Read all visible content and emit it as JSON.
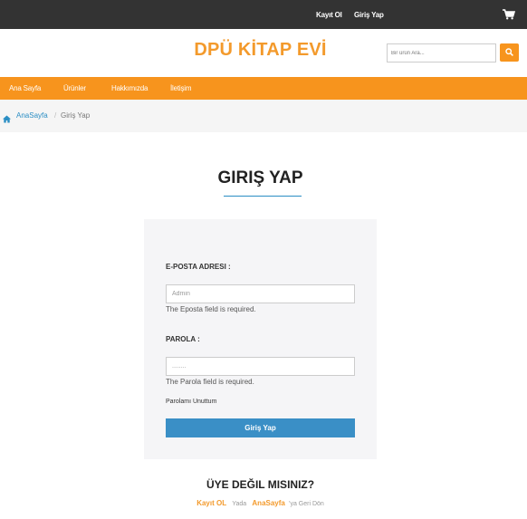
{
  "topbar": {
    "register_label": "Kayıt Ol",
    "login_label": "Giriş Yap",
    "cart_icon": "shopping-cart-icon"
  },
  "header": {
    "logo": "DPÜ KİTAP EVİ",
    "search_placeholder": "Bir ürün Ara...",
    "search_icon": "search-icon"
  },
  "nav": {
    "items": [
      {
        "label": "Ana Sayfa"
      },
      {
        "label": "Ürünler"
      },
      {
        "label": "Hakkımızda"
      },
      {
        "label": "İletişim"
      }
    ]
  },
  "breadcrumb": {
    "home_icon": "home-icon",
    "home_label": "AnaSayfa",
    "separator": "/",
    "current": "Giriş Yap"
  },
  "form": {
    "title": "GIRIŞ YAP",
    "email_label": "E-POSTA ADRESI :",
    "email_placeholder": "Admin",
    "email_error": "The Eposta field is required.",
    "password_label": "PAROLA :",
    "password_value": "........",
    "password_error": "The Parola field is required.",
    "forgot_label": "Parolamı Unuttum",
    "submit_label": "Giriş Yap"
  },
  "footer_prompt": {
    "heading": "ÜYE DEĞIL MISINIZ?",
    "register_link": "Kayıt OL",
    "or_text": "Yada",
    "home_link": "AnaSayfa",
    "back_text": "'ya Geri Dön"
  },
  "colors": {
    "accent_orange": "#f7941d",
    "link_blue": "#2a8ec4",
    "topbar": "#333333",
    "button_blue": "#3a8fc6"
  }
}
